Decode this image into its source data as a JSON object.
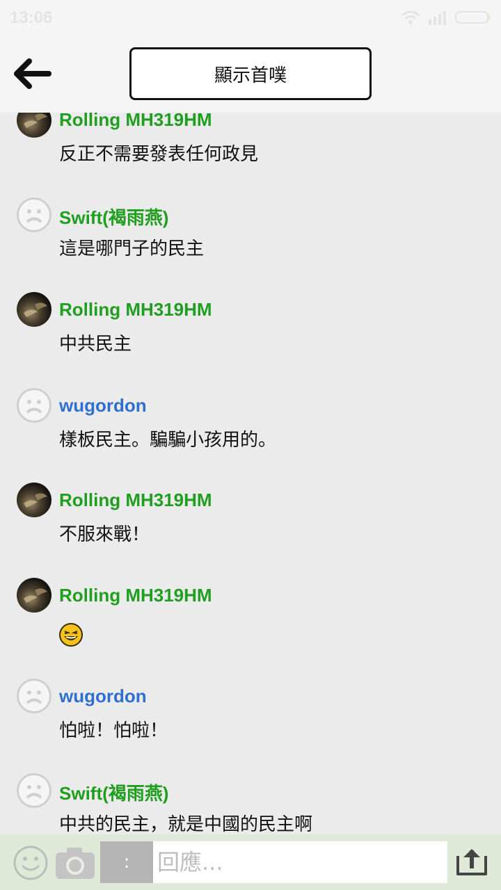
{
  "status_bar": {
    "time": "13:06"
  },
  "header": {
    "back_icon": "arrow-left-icon",
    "title_button": "顯示首噗"
  },
  "messages": [
    {
      "author": "Rolling MH319HM",
      "avatar": "photo",
      "name_color": "#1f9e1f",
      "text": "反正不需要發表任何政見"
    },
    {
      "author": "Swift(褐雨燕)",
      "avatar": "sad-face",
      "name_color": "#1f9e1f",
      "text": "這是哪門子的民主"
    },
    {
      "author": "Rolling MH319HM",
      "avatar": "photo",
      "name_color": "#1f9e1f",
      "text": "中共民主"
    },
    {
      "author": "wugordon",
      "avatar": "sad-face",
      "name_color": "#2f6fd0",
      "text": "樣板民主。騙騙小孩用的。"
    },
    {
      "author": "Rolling MH319HM",
      "avatar": "photo",
      "name_color": "#1f9e1f",
      "text": "不服來戰！"
    },
    {
      "author": "Rolling MH319HM",
      "avatar": "photo",
      "name_color": "#1f9e1f",
      "emoji": "laughing-emoji-icon"
    },
    {
      "author": "wugordon",
      "avatar": "sad-face",
      "name_color": "#2f6fd0",
      "text": "怕啦！怕啦！"
    },
    {
      "author": "Swift(褐雨燕)",
      "avatar": "sad-face",
      "name_color": "#1f9e1f",
      "text": "中共的民主，就是中國的民主啊"
    }
  ],
  "composer": {
    "emoji_icon": "smiley-icon",
    "camera_icon": "camera-icon",
    "colon_button": ":",
    "reply_placeholder": "回應...",
    "send_icon": "upload-send-icon"
  },
  "colors": {
    "green_name": "#1f9e1f",
    "blue_name": "#2f6fd0",
    "composer_bg": "#dfe9d8"
  }
}
